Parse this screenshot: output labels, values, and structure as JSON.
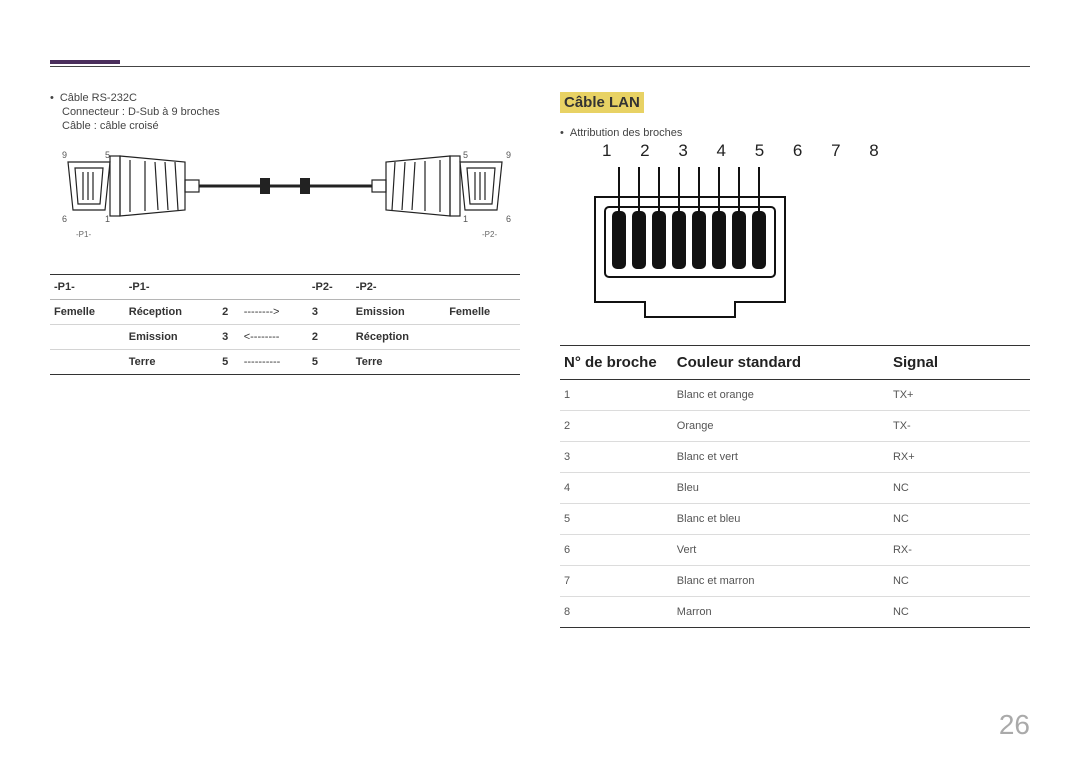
{
  "page_number": "26",
  "left": {
    "bullet": "Câble RS-232C",
    "line1": "Connecteur : D-Sub à 9 broches",
    "line2": "Câble : câble croisé",
    "diagram": {
      "l9": "9",
      "l5": "5",
      "l6": "6",
      "l1": "1",
      "r5": "5",
      "r9": "9",
      "r1": "1",
      "r6": "6",
      "lp": "-P1-",
      "rp": "-P2-"
    },
    "headers": {
      "h1": "-P1-",
      "h2": "-P1-",
      "h3": "",
      "h4": "-P2-",
      "h5": "-P2-",
      "h6": ""
    },
    "rows": [
      {
        "c1": "Femelle",
        "c2": "Réception",
        "c3": "2",
        "c4": "-------->",
        "c5": "3",
        "c6": "Emission",
        "c7": "Femelle"
      },
      {
        "c1": "",
        "c2": "Emission",
        "c3": "3",
        "c4": "<--------",
        "c5": "2",
        "c6": "Réception",
        "c7": ""
      },
      {
        "c1": "",
        "c2": "Terre",
        "c3": "5",
        "c4": "----------",
        "c5": "5",
        "c6": "Terre",
        "c7": ""
      }
    ]
  },
  "right": {
    "heading": "Câble LAN",
    "bullet": "Attribution des broches",
    "pin_numbers": "1 2 3 4 5 6 7 8",
    "th1": "N° de broche",
    "th2": "Couleur standard",
    "th3": "Signal",
    "rows": [
      {
        "n": "1",
        "c": "Blanc et orange",
        "s": "TX+"
      },
      {
        "n": "2",
        "c": "Orange",
        "s": "TX-"
      },
      {
        "n": "3",
        "c": "Blanc et vert",
        "s": "RX+"
      },
      {
        "n": "4",
        "c": "Bleu",
        "s": "NC"
      },
      {
        "n": "5",
        "c": "Blanc et bleu",
        "s": "NC"
      },
      {
        "n": "6",
        "c": "Vert",
        "s": "RX-"
      },
      {
        "n": "7",
        "c": "Blanc et marron",
        "s": "NC"
      },
      {
        "n": "8",
        "c": "Marron",
        "s": "NC"
      }
    ]
  }
}
